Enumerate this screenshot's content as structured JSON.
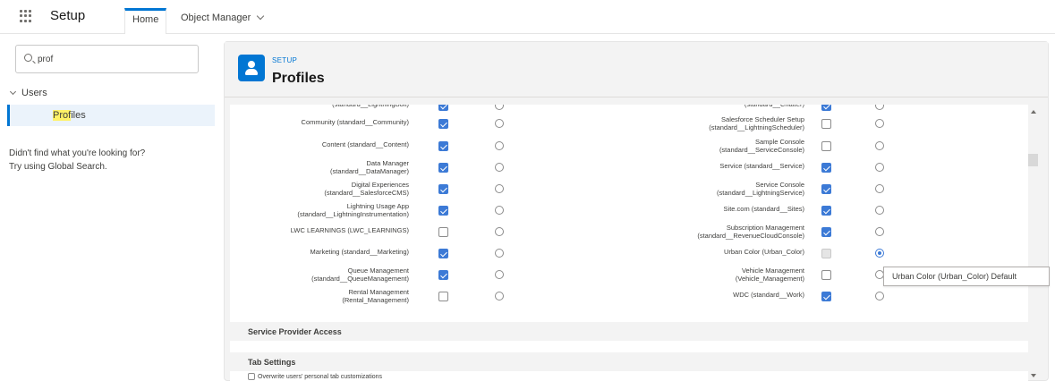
{
  "nav": {
    "app_name": "Setup",
    "tabs": [
      {
        "label": "Home"
      },
      {
        "label": "Object Manager"
      }
    ]
  },
  "sidebar": {
    "search_value": "prof",
    "tree_parent": "Users",
    "tree_item_prefix": "Prof",
    "tree_item_suffix": "iles",
    "not_found_line1": "Didn't find what you're looking for?",
    "not_found_line2": "Try using Global Search."
  },
  "header": {
    "eyebrow": "SETUP",
    "title": "Profiles"
  },
  "apps_left": [
    {
      "line1": "(standard__LightningBolt)",
      "line2": "",
      "checked": true,
      "default": false
    },
    {
      "line1": "Community (standard__Community)",
      "line2": "",
      "checked": true,
      "default": false
    },
    {
      "line1": "Content (standard__Content)",
      "line2": "",
      "checked": true,
      "default": false
    },
    {
      "line1": "Data Manager",
      "line2": "(standard__DataManager)",
      "checked": true,
      "default": false
    },
    {
      "line1": "Digital Experiences",
      "line2": "(standard__SalesforceCMS)",
      "checked": true,
      "default": false
    },
    {
      "line1": "Lightning Usage App",
      "line2": "(standard__LightningInstrumentation)",
      "checked": true,
      "default": false
    },
    {
      "line1": "LWC LEARNINGS (LWC_LEARNINGS)",
      "line2": "",
      "checked": false,
      "default": false
    },
    {
      "line1": "Marketing (standard__Marketing)",
      "line2": "",
      "checked": true,
      "default": false
    },
    {
      "line1": "Queue Management",
      "line2": "(standard__QueueManagement)",
      "checked": true,
      "default": false
    },
    {
      "line1": "Rental Management",
      "line2": "(Rental_Management)",
      "checked": false,
      "default": false
    }
  ],
  "apps_right": [
    {
      "line1": "(standard__Chatter)",
      "line2": "",
      "checked": true,
      "disabled": false,
      "default": false
    },
    {
      "line1": "Salesforce Scheduler Setup",
      "line2": "(standard__LightningScheduler)",
      "checked": false,
      "disabled": false,
      "default": false
    },
    {
      "line1": "Sample Console",
      "line2": "(standard__ServiceConsole)",
      "checked": false,
      "disabled": false,
      "default": false
    },
    {
      "line1": "Service (standard__Service)",
      "line2": "",
      "checked": true,
      "disabled": false,
      "default": false
    },
    {
      "line1": "Service Console",
      "line2": "(standard__LightningService)",
      "checked": true,
      "disabled": false,
      "default": false
    },
    {
      "line1": "Site.com (standard__Sites)",
      "line2": "",
      "checked": true,
      "disabled": false,
      "default": false
    },
    {
      "line1": "Subscription Management",
      "line2": "(standard__RevenueCloudConsole)",
      "checked": true,
      "disabled": false,
      "default": false
    },
    {
      "line1": "Urban Color (Urban_Color)",
      "line2": "",
      "checked": true,
      "disabled": true,
      "default": true
    },
    {
      "line1": "Vehicle Management",
      "line2": "(Vehicle_Management)",
      "checked": false,
      "disabled": false,
      "default": false
    },
    {
      "line1": "WDC (standard__Work)",
      "line2": "",
      "checked": true,
      "disabled": false,
      "default": false
    }
  ],
  "sections": {
    "service_provider": "Service Provider Access",
    "tab_settings": "Tab Settings",
    "overwrite": "Overwrite users' personal tab customizations"
  },
  "tooltip": "Urban Color (Urban_Color) Default",
  "colors": {
    "accent": "#0176d3",
    "checkbox": "#3c7ad6",
    "header_bg": "#f3f3f3"
  }
}
